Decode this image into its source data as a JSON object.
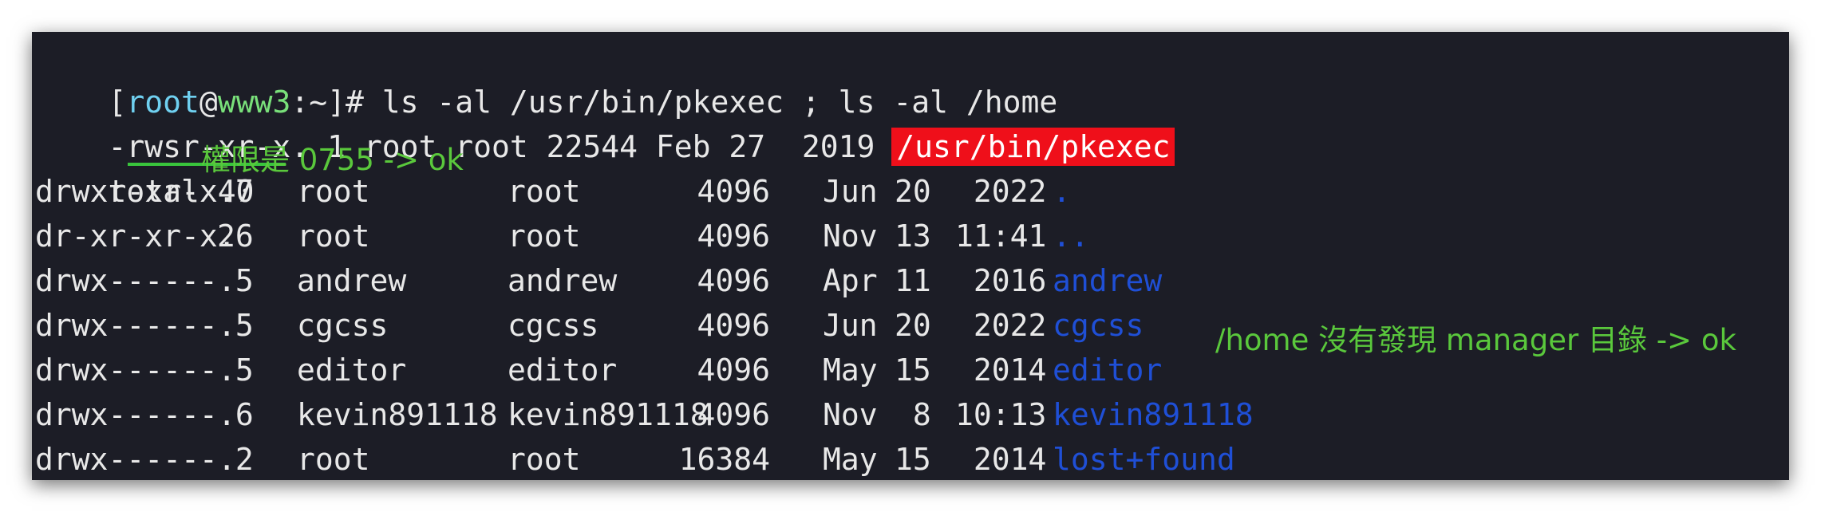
{
  "prompt": {
    "open": "[",
    "user": "root",
    "at": "@",
    "host": "www3",
    "path": ":~",
    "close": "]#",
    "command": " ls -al /usr/bin/pkexec ; ls -al /home"
  },
  "pkexec": {
    "dash": "-",
    "perm": "rwsr-xr-x",
    "rest": ". 1 root root 22544 Feb 27  2019 ",
    "path": "/usr/bin/pkexec"
  },
  "total": "total 40",
  "annotations": {
    "permission": "權限是 0755 -> ok",
    "home": "/home 沒有發現 manager 目錄 -> ok"
  },
  "listing": [
    {
      "perms": "drwxr-xr-x.",
      "links": " 7",
      "owner": "root",
      "group": "root",
      "size": "4096",
      "month": "Jun",
      "day": "20",
      "time": " 2022",
      "name": "."
    },
    {
      "perms": "dr-xr-xr-x.",
      "links": "26",
      "owner": "root",
      "group": "root",
      "size": "4096",
      "month": "Nov",
      "day": "13",
      "time": "11:41",
      "name": ".."
    },
    {
      "perms": "drwx------.",
      "links": " 5",
      "owner": "andrew",
      "group": "andrew",
      "size": "4096",
      "month": "Apr",
      "day": "11",
      "time": " 2016",
      "name": "andrew"
    },
    {
      "perms": "drwx------.",
      "links": " 5",
      "owner": "cgcss",
      "group": "cgcss",
      "size": "4096",
      "month": "Jun",
      "day": "20",
      "time": " 2022",
      "name": "cgcss"
    },
    {
      "perms": "drwx------.",
      "links": " 5",
      "owner": "editor",
      "group": "editor",
      "size": "4096",
      "month": "May",
      "day": "15",
      "time": " 2014",
      "name": "editor"
    },
    {
      "perms": "drwx------.",
      "links": " 6",
      "owner": "kevin891118",
      "group": "kevin891118",
      "size": "4096",
      "month": "Nov",
      "day": " 8",
      "time": "10:13",
      "name": "kevin891118"
    },
    {
      "perms": "drwx------.",
      "links": " 2",
      "owner": "root",
      "group": "root",
      "size": "16384",
      "month": "May",
      "day": "15",
      "time": " 2014",
      "name": "lost+found"
    }
  ],
  "colors": {
    "terminal_bg": "#1c1d26",
    "text": "#e8e8e8",
    "user": "#6fd0f0",
    "host": "#79e07a",
    "directory": "#1f4fd6",
    "highlight": "#ef0f1a",
    "annotation": "#5ac83c"
  }
}
